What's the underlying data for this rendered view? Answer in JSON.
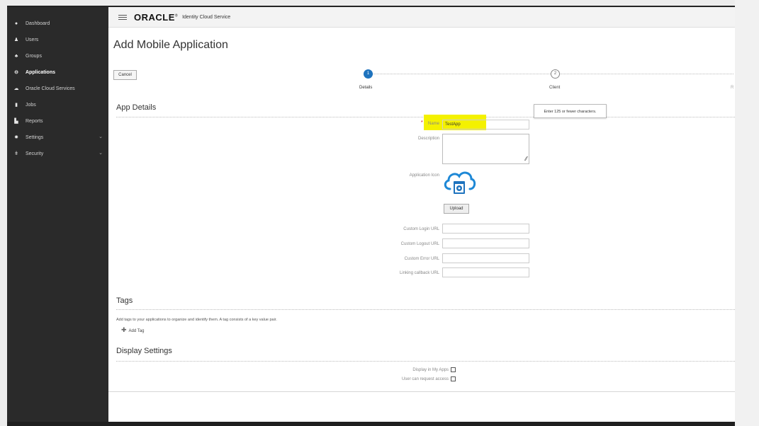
{
  "header": {
    "brand": "ORACLE",
    "brand_mark": "®",
    "product": "Identity Cloud Service"
  },
  "sidebar": {
    "items": [
      {
        "label": "Dashboard",
        "icon": "dashboard-icon",
        "glyph": "●"
      },
      {
        "label": "Users",
        "icon": "user-icon",
        "glyph": "♟"
      },
      {
        "label": "Groups",
        "icon": "groups-icon",
        "glyph": "♣"
      },
      {
        "label": "Applications",
        "icon": "applications-icon",
        "glyph": "⊖",
        "active": true
      },
      {
        "label": "Oracle Cloud Services",
        "icon": "cloud-icon",
        "glyph": "☁"
      },
      {
        "label": "Jobs",
        "icon": "jobs-icon",
        "glyph": "▮"
      },
      {
        "label": "Reports",
        "icon": "reports-icon",
        "glyph": "▙"
      },
      {
        "label": "Settings",
        "icon": "gear-icon",
        "glyph": "✹",
        "has_children": true
      },
      {
        "label": "Security",
        "icon": "key-icon",
        "glyph": "ǂ",
        "has_children": true
      }
    ]
  },
  "page": {
    "title": "Add Mobile Application",
    "cancel_label": "Cancel"
  },
  "stepper": {
    "steps": [
      {
        "number": "1",
        "label": "Details",
        "state": "active"
      },
      {
        "number": "2",
        "label": "Client",
        "state": "pending"
      },
      {
        "number": "",
        "label": "R",
        "state": "pending"
      }
    ]
  },
  "app_details": {
    "title": "App Details",
    "name_label": "Name",
    "name_required": "*",
    "name_value": "TestApp",
    "name_tooltip": "Enter 125 or fewer characters.",
    "description_label": "Description",
    "description_value": "",
    "icon_label": "Application Icon",
    "icon_name": "cloud-app-icon",
    "upload_label": "Upload",
    "custom_login_label": "Custom Login URL",
    "custom_logout_label": "Custom Logout URL",
    "custom_error_label": "Custom Error URL",
    "linking_callback_label": "Linking callback URL"
  },
  "tags": {
    "title": "Tags",
    "description": "Add tags to your applications to organize and identify them. A tag consists of a key value pair.",
    "add_label": "Add Tag",
    "add_icon": "plus-icon"
  },
  "display_settings": {
    "title": "Display Settings",
    "display_in_my_apps_label": "Display in My Apps",
    "display_in_my_apps_checked": false,
    "user_can_request_label": "User can request access",
    "user_can_request_checked": false
  },
  "colors": {
    "sidebar_bg": "#2a2a2a",
    "accent": "#1e73be",
    "highlight": "#f4f100"
  }
}
